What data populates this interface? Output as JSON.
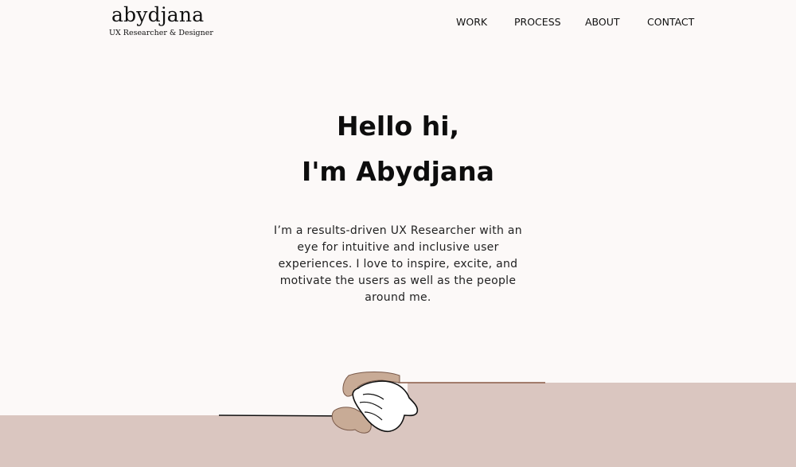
{
  "header": {
    "logo_name": "abydjana",
    "logo_tagline": "UX Researcher & Designer",
    "nav": [
      {
        "label": "WORK"
      },
      {
        "label": "PROCESS"
      },
      {
        "label": "ABOUT"
      },
      {
        "label": "CONTACT"
      }
    ]
  },
  "hero": {
    "title_line1": "Hello hi,",
    "title_line2": "I'm Abydjana",
    "bio": "I’m a results-driven UX Researcher with an eye for intuitive and inclusive user experiences. I love to inspire, excite, and motivate the users as well as the people around me."
  },
  "illustration": {
    "name": "handshake-illustration",
    "colors": {
      "ground": "#dac6c0",
      "hand_tan": "#c8ab96",
      "hand_light": "#ffffff",
      "outline": "#111111"
    }
  },
  "colors": {
    "background": "#fcf9f8",
    "text": "#111111"
  }
}
